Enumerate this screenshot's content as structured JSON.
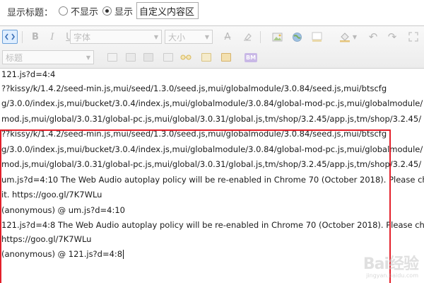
{
  "title_setting": {
    "label": "显示标题：",
    "options": [
      {
        "label": "不显示",
        "checked": false
      },
      {
        "label": "显示",
        "checked": true
      }
    ],
    "custom_value": "自定义内容区"
  },
  "toolbar": {
    "font_select": "字体",
    "size_select": "大小",
    "heading_select": "标题",
    "bold": "B",
    "italic": "I",
    "underline": "U",
    "strike": "A",
    "html_mode": "<>",
    "bm": "BM"
  },
  "content": {
    "lines": [
      "121.js?d=4:4",
      "??kissy/k/1.4.2/seed-min.js,mui/seed/1.3.0/seed.js,mui/globalmodule/3.0.84/seed.js,mui/btscfg",
      "g/3.0.0/index.js,mui/bucket/3.0.4/index.js,mui/globalmodule/3.0.84/global-mod-pc.js,mui/globalmodule/",
      "mod.js,mui/global/3.0.31/global-pc.js,mui/global/3.0.31/global.js,tm/shop/3.2.45/app.js,tm/shop/3.2.45/",
      "??kissy/k/1.4.2/seed-min.js,mui/seed/1.3.0/seed.js,mui/globalmodule/3.0.84/seed.js,mui/btscfg",
      "g/3.0.0/index.js,mui/bucket/3.0.4/index.js,mui/globalmodule/3.0.84/global-mod-pc.js,mui/globalmodule/",
      "mod.js,mui/global/3.0.31/global-pc.js,mui/global/3.0.31/global.js,tm/shop/3.2.45/app.js,tm/shop/3.2.45/",
      "um.js?d=4:10 The Web Audio autoplay policy will be re-enabled in Chrome 70 (October 2018). Please ch",
      "it. https://goo.gl/7K7WLu",
      "(anonymous) @ um.js?d=4:10",
      "121.js?d=4:8 The Web Audio autoplay policy will be re-enabled in Chrome 70 (October 2018). Please ch",
      "https://goo.gl/7K7WLu",
      "(anonymous) @ 121.js?d=4:8"
    ]
  },
  "watermark": {
    "logo_a": "Bai",
    "logo_b": "经验",
    "url": "jingyan.baidu.com"
  },
  "colors": {
    "highlight_border": "#e3202a",
    "active_button": "#3b6fb5"
  }
}
